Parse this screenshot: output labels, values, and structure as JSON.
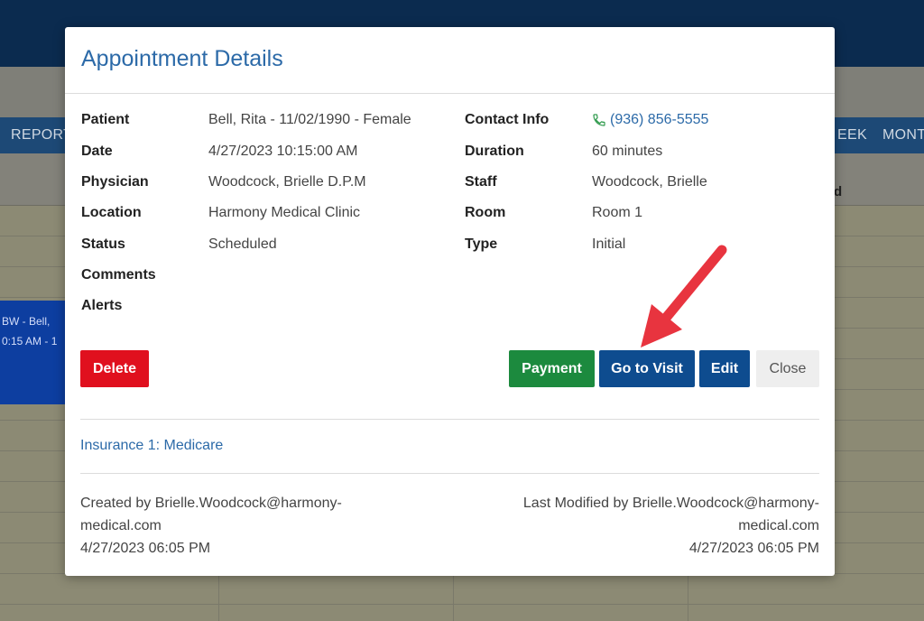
{
  "background": {
    "nav_left": "REPORT",
    "nav_week": "EEK",
    "nav_month": "MONT",
    "col_header_fragment": "d",
    "event_line1": "BW - Bell,",
    "event_line2": "0:15 AM - 1"
  },
  "modal": {
    "title": "Appointment Details",
    "left_fields": [
      {
        "label": "Patient",
        "value": "Bell, Rita - 11/02/1990 - Female"
      },
      {
        "label": "Date",
        "value": "4/27/2023 10:15:00 AM"
      },
      {
        "label": "Physician",
        "value": "Woodcock, Brielle D.P.M"
      },
      {
        "label": "Location",
        "value": "Harmony Medical Clinic"
      },
      {
        "label": "Status",
        "value": "Scheduled"
      },
      {
        "label": "Comments",
        "value": ""
      },
      {
        "label": "Alerts",
        "value": ""
      }
    ],
    "right_fields": [
      {
        "label": "Contact Info",
        "value": "(936) 856-5555",
        "icon": "phone-icon"
      },
      {
        "label": "Duration",
        "value": "60 minutes"
      },
      {
        "label": "Staff",
        "value": "Woodcock, Brielle"
      },
      {
        "label": "Room",
        "value": "Room 1"
      },
      {
        "label": "Type",
        "value": "Initial"
      }
    ],
    "buttons": {
      "delete": "Delete",
      "payment": "Payment",
      "go_to_visit": "Go to Visit",
      "edit": "Edit",
      "close": "Close"
    },
    "insurance": "Insurance 1: Medicare",
    "created": {
      "line1": "Created by Brielle.Woodcock@harmony-",
      "line2": "medical.com",
      "line3": "4/27/2023 06:05 PM"
    },
    "modified": {
      "line1": "Last Modified by Brielle.Woodcock@harmony-",
      "line2": "medical.com",
      "line3": "4/27/2023 06:05 PM"
    }
  },
  "colors": {
    "title": "#2c6aa8",
    "delete": "#e0101e",
    "payment": "#1c8a3e",
    "primary": "#0e4c8f",
    "arrow": "#e8343f"
  }
}
